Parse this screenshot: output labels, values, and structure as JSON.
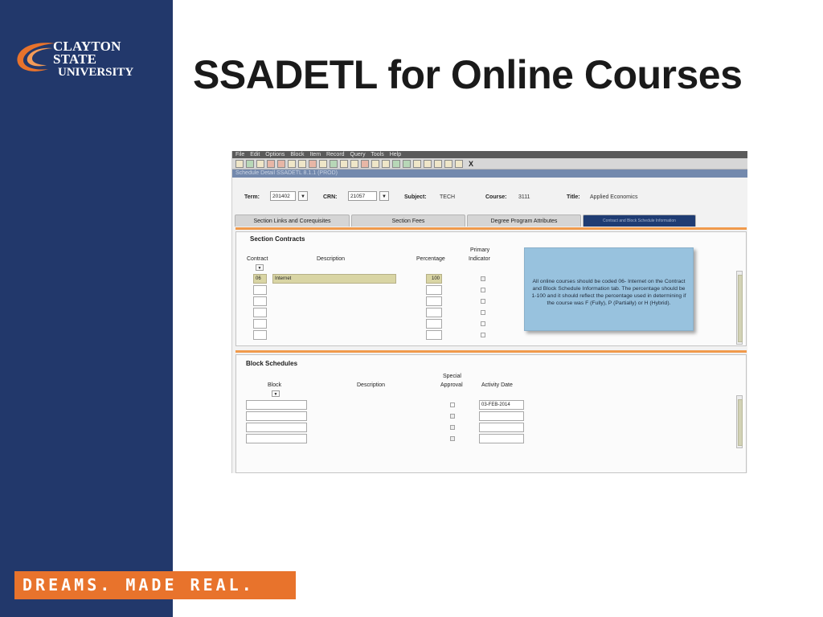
{
  "slide": {
    "title": "SSADETL for Online Courses",
    "logo_line1": "CLAYTON STATE",
    "logo_line2": "UNIVERSITY",
    "tagline": "DREAMS. MADE REAL."
  },
  "app": {
    "menu": [
      "File",
      "Edit",
      "Options",
      "Block",
      "Item",
      "Record",
      "Query",
      "Tools",
      "Help"
    ],
    "window_title": "Schedule Detail SSADETL  8.1.1   (PROD)",
    "toolbar_close": "X"
  },
  "key": {
    "term_label": "Term:",
    "term_value": "201402",
    "crn_label": "CRN:",
    "crn_value": "21057",
    "subject_label": "Subject:",
    "subject_value": "TECH",
    "course_label": "Course:",
    "course_value": "3111",
    "title_label": "Title:",
    "title_value": "Applied Economics"
  },
  "tabs": [
    {
      "label": "Section Links and Corequisites"
    },
    {
      "label": "Section Fees"
    },
    {
      "label": "Degree Program Attributes"
    },
    {
      "label": "Contract and Block Schedule Information"
    }
  ],
  "section_contracts": {
    "title": "Section Contracts",
    "headers": {
      "contract": "Contract",
      "description": "Description",
      "percentage": "Percentage",
      "primary": "Primary",
      "indicator": "Indicator"
    },
    "rows": [
      {
        "contract": "06",
        "description": "Internet",
        "percentage": "100"
      },
      {
        "contract": "",
        "description": "",
        "percentage": ""
      },
      {
        "contract": "",
        "description": "",
        "percentage": ""
      },
      {
        "contract": "",
        "description": "",
        "percentage": ""
      },
      {
        "contract": "",
        "description": "",
        "percentage": ""
      },
      {
        "contract": "",
        "description": "",
        "percentage": ""
      }
    ]
  },
  "callout": {
    "text": "All online courses should be coded 06- Internet on the Contract and Block Schedule Information tab. The percentage should be 1-100 and it should reflect the percentage used in determining if the course was F (Fully), P (Partially) or H (Hybrid)."
  },
  "block_schedules": {
    "title": "Block Schedules",
    "headers": {
      "block": "Block",
      "description": "Description",
      "special": "Special",
      "approval": "Approval",
      "activity_date": "Activity Date"
    },
    "rows": [
      {
        "block": "",
        "activity_date": "03-FEB-2014"
      },
      {
        "block": "",
        "activity_date": ""
      },
      {
        "block": "",
        "activity_date": ""
      },
      {
        "block": "",
        "activity_date": ""
      }
    ]
  },
  "colors": {
    "sidebar": "#22386b",
    "tagline_bg": "#e8732c",
    "logo_swoosh": "#e8732c",
    "active_tab": "#1f3c73",
    "callout": "#98c2de",
    "divider": "#f09a4c",
    "highlight_row": "#d9d5a4"
  }
}
